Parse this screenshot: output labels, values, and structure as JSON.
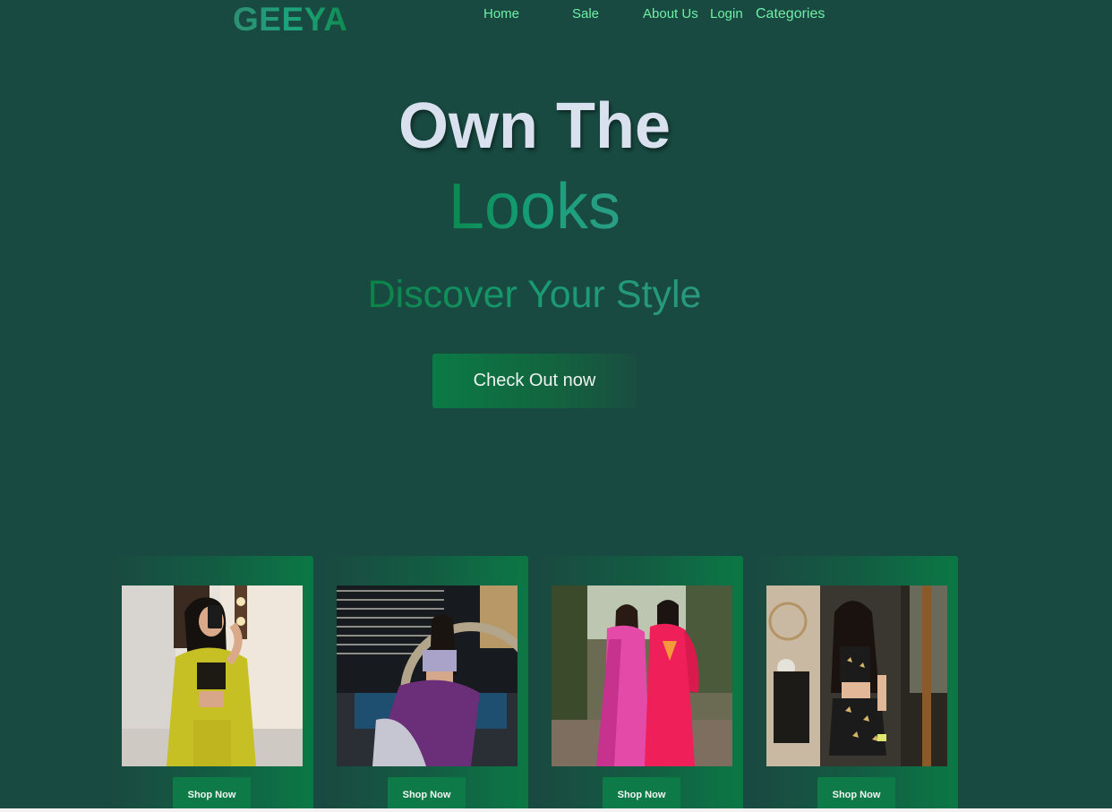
{
  "brand": {
    "logo": "GEEYA"
  },
  "nav": {
    "home": "Home",
    "sale": "Sale",
    "about": "About Us",
    "login": "Login",
    "categories": "Categories"
  },
  "hero": {
    "line1": "Own The",
    "line2": "Looks",
    "subtitle": "Discover Your Style",
    "cta": "Check Out now"
  },
  "products": [
    {
      "button": "Shop Now",
      "image": "woman in yellow co-ord set taking mirror selfie"
    },
    {
      "button": "Shop Now",
      "image": "woman in purple lehenga seated outdoors at night"
    },
    {
      "button": "Shop Now",
      "image": "two women in pink and red salwar suits"
    },
    {
      "button": "Shop Now",
      "image": "smiling woman in black printed co-ord set"
    }
  ],
  "colors": {
    "background": "#184a41",
    "nav_link": "#6ef0a6",
    "accent_green": "#0e7a47",
    "hero_text": "#d9e0ee"
  }
}
